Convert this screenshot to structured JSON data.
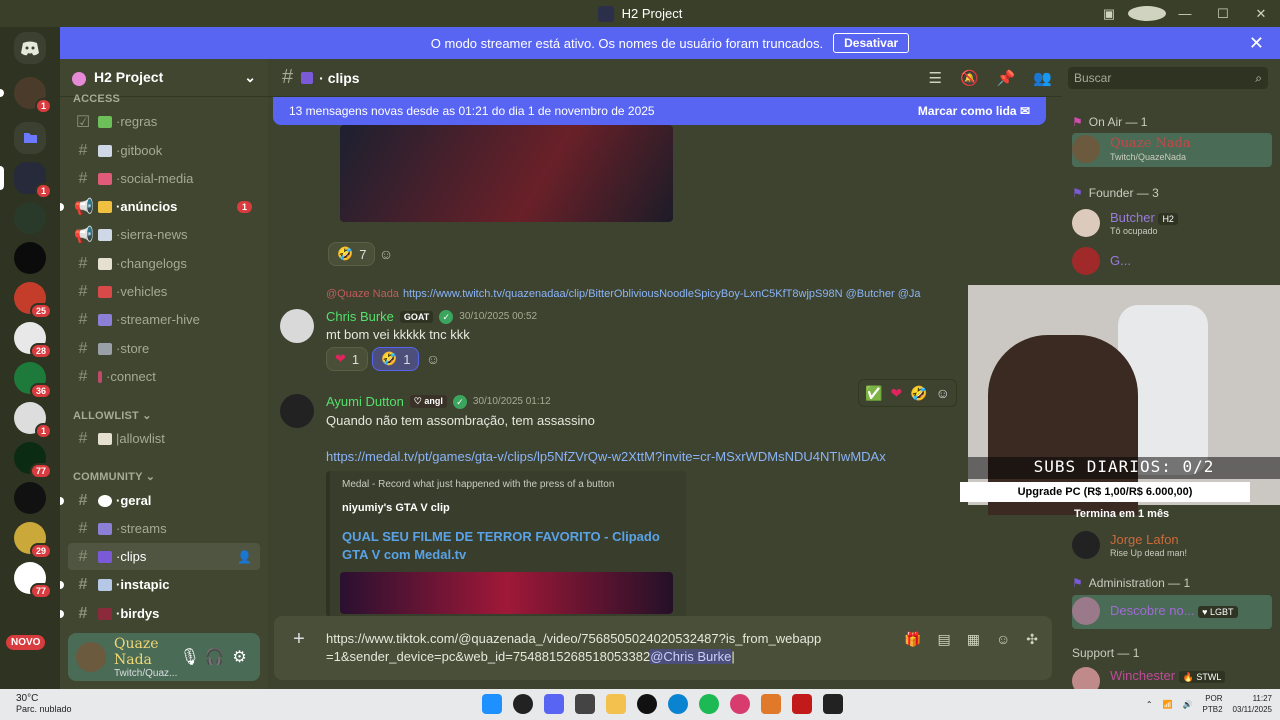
{
  "window": {
    "title": "H2 Project"
  },
  "banner": {
    "text": "O modo streamer está ativo. Os nomes de usuário foram truncados.",
    "button": "Desativar"
  },
  "rail": {
    "badges": [
      "1",
      "1",
      "25",
      "28",
      "36",
      "1",
      "77",
      "29",
      "77"
    ],
    "novo": "NOVO"
  },
  "guild": {
    "name": "H2 Project"
  },
  "categories": {
    "access": "ACCESS",
    "allowlist": "ALLOWLIST",
    "community": "COMMUNITY"
  },
  "channels": [
    {
      "label": "regras"
    },
    {
      "label": "gitbook"
    },
    {
      "label": "social-media"
    },
    {
      "label": "anúncios",
      "badge": "1"
    },
    {
      "label": "sierra-news"
    },
    {
      "label": "changelogs"
    },
    {
      "label": "vehicles"
    },
    {
      "label": "streamer-hive"
    },
    {
      "label": "store"
    },
    {
      "label": "connect"
    },
    {
      "label": "allowlist"
    },
    {
      "label": "geral"
    },
    {
      "label": "streams"
    },
    {
      "label": "clips"
    },
    {
      "label": "instapic"
    },
    {
      "label": "birdys"
    }
  ],
  "user": {
    "name": "Quaze Nada",
    "status": "Twitch/Quaz..."
  },
  "chat": {
    "channel": "clips",
    "new_messages": "13 mensagens novas desde as 01:21 do dia 1 de novembro de 2025",
    "mark_read": "Marcar como lida",
    "reaction1": {
      "count": "7"
    },
    "reply": {
      "name": "@Quaze Nada",
      "text": "https://www.twitch.tv/quazenadaa/clip/BitterObliviousNoodleSpicyBoy-LxnC5KfT8wjpS98N @Butcher @Ja"
    },
    "msg1": {
      "author": "Chris Burke",
      "tag": "GOAT",
      "time": "30/10/2025 00:52",
      "text": "mt bom vei kkkkk tnc kkk",
      "r1": "1",
      "r2": "1"
    },
    "msg2": {
      "author": "Ayumi Dutton",
      "tag": "angl",
      "time": "30/10/2025 01:12",
      "text": "Quando não tem assombração, tem assassino",
      "link": "https://medal.tv/pt/games/gta-v/clips/lp5NfZVrQw-w2XttM?invite=cr-MSxrWDMsNDU4NTIwMDAx"
    },
    "embed": {
      "provider": "Medal - Record what just happened with the press of a button",
      "author": "niyumiy's GTA V clip",
      "title": "QUAL SEU FILME DE TERROR FAVORITO - Clipado GTA V com Medal.tv"
    },
    "composer": {
      "text": "https://www.tiktok.com/@quazenada_/video/7568505024020532487?is_from_webapp=1&sender_device=pc&web_id=7548815268518053382",
      "mention": "@Chris Burke"
    }
  },
  "members": {
    "search_placeholder": "Buscar",
    "groups": [
      {
        "title": "On Air — 1"
      },
      {
        "title": "Founder — 3"
      },
      {
        "title": "Administration — 1"
      },
      {
        "title": "Support — 1"
      }
    ],
    "list": [
      {
        "name": "Quaze Nada",
        "sub": "Twitch/QuazeNada"
      },
      {
        "name": "Butcher",
        "tag": "H2",
        "sub": "Tô ocupado"
      },
      {
        "name": "G..."
      },
      {
        "name": "Jorge Lafon",
        "sub": "Rise Up dead man!"
      },
      {
        "name": "Descobre no...",
        "tag": "LGBT"
      },
      {
        "name": "Winchester",
        "tag": "STWL"
      }
    ],
    "ends_label": "Termina em 1 mês"
  },
  "overlay": {
    "subs": "SUBS DIARIOS: 0/2",
    "goal": "Upgrade PC (R$ 1,00/R$ 6.000,00)"
  },
  "taskbar": {
    "temp": "30°C",
    "weather": "Parc. nublado",
    "lang": "POR",
    "lang2": "PTB2",
    "time": "11:27",
    "date": "03/11/2025"
  }
}
